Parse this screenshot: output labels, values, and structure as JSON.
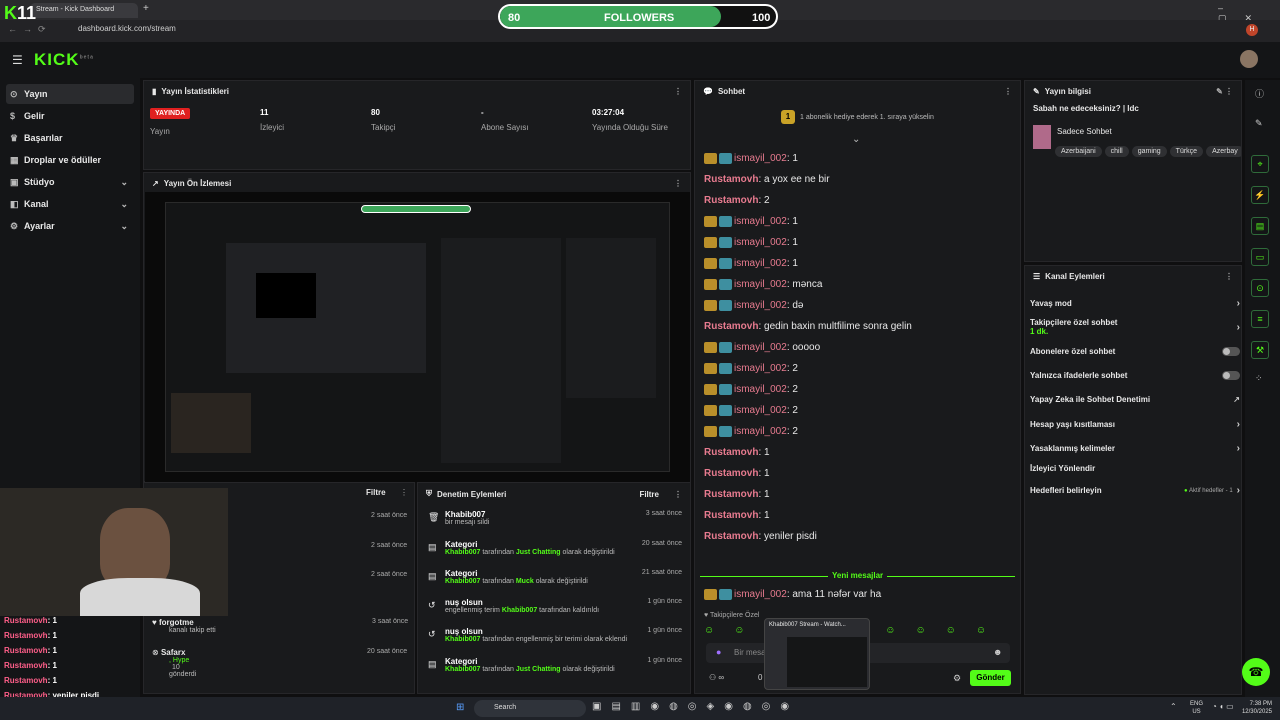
{
  "browser": {
    "tab_title": "Stream - Kick Dashboard",
    "url": "dashboard.kick.com/stream",
    "profile_initial": "H"
  },
  "overlay": {
    "logo_k": "K",
    "logo_num": "11",
    "followers_left": "80",
    "followers_label": "FOLLOWERS",
    "followers_right": "100",
    "followers_progress": 0.8
  },
  "app": {
    "logo": "KICK",
    "logo_sup": "beta"
  },
  "sidebar": {
    "items": [
      {
        "label": "Yayın",
        "icon": "broadcast-icon"
      },
      {
        "label": "Gelir",
        "icon": "money-icon"
      },
      {
        "label": "Başarılar",
        "icon": "trophy-icon"
      },
      {
        "label": "Droplar ve ödüller",
        "icon": "gift-icon"
      },
      {
        "label": "Stüdyo",
        "icon": "studio-icon"
      },
      {
        "label": "Kanal",
        "icon": "channel-icon"
      },
      {
        "label": "Ayarlar",
        "icon": "gear-icon"
      }
    ]
  },
  "stats": {
    "title": "Yayın İstatistikleri",
    "live": "YAYINDA",
    "live_label": "Yayın",
    "viewers": "11",
    "viewers_label": "İzleyici",
    "followers": "80",
    "followers_label": "Takipçi",
    "subs": "-",
    "subs_label": "Abone Sayısı",
    "uptime": "03:27:04",
    "uptime_label": "Yayında Olduğu Süre"
  },
  "preview": {
    "title": "Yayın Ön İzlemesi"
  },
  "activity": {
    "filter": "Filtre",
    "times": [
      "2 saat önce",
      "2 saat önce",
      "2 saat önce"
    ],
    "rows": [
      {
        "name": "forgotme",
        "desc": "kanalı takip etti",
        "time": "3 saat önce"
      },
      {
        "name": "Safarx",
        "desc": ", Hype",
        "extra": "10",
        "extra2": "gönderdi",
        "time": "20 saat önce"
      }
    ]
  },
  "mod_log": {
    "title": "Denetim Eylemleri",
    "filter": "Filtre",
    "rows": [
      {
        "title": "Khabib007",
        "desc": "bir mesajı sildi",
        "time": "3 saat önce"
      },
      {
        "title": "Kategori",
        "user": "Khabib007",
        "mid": "tarafından",
        "cat": "Just Chatting",
        "end": "olarak değiştirildi",
        "time": "20 saat önce"
      },
      {
        "title": "Kategori",
        "user": "Khabib007",
        "mid": "tarafından",
        "cat": "Muck",
        "end": "olarak değiştirildi",
        "time": "21 saat önce"
      },
      {
        "title": "nuş olsun",
        "desc": "engellenmiş terim",
        "user": "Khabib007",
        "end": "tarafından kaldırıldı",
        "time": "1 gün önce"
      },
      {
        "title": "nuş olsun",
        "user": "Khabib007",
        "end": "tarafından engellenmiş bir terimi olarak eklendi",
        "time": "1 gün önce"
      },
      {
        "title": "Kategori",
        "user": "Khabib007",
        "mid": "tarafından",
        "cat": "Just Chatting",
        "end": "olarak değiştirildi",
        "time": "1 gün önce"
      }
    ]
  },
  "chat": {
    "title": "Sohbet",
    "pinned": "1 abonelik hediye ederek 1. sıraya yükselin",
    "pinned_num": "1",
    "new_messages": "Yeni mesajlar",
    "placeholder": "Bir mesaj",
    "send": "Gönder",
    "followers_only": "Takipçilere Özel",
    "viewers": "0",
    "messages": [
      {
        "user": "ismayil_002",
        "text": "1",
        "badges": true
      },
      {
        "user": "Rustamovh",
        "text": "a yox ee ne bir",
        "badges": false
      },
      {
        "user": "Rustamovh",
        "text": "2",
        "badges": false
      },
      {
        "user": "ismayil_002",
        "text": "1",
        "badges": true
      },
      {
        "user": "ismayil_002",
        "text": "1",
        "badges": true
      },
      {
        "user": "ismayil_002",
        "text": "1",
        "badges": true
      },
      {
        "user": "ismayil_002",
        "text": "mənca",
        "badges": true
      },
      {
        "user": "ismayil_002",
        "text": "də",
        "badges": true
      },
      {
        "user": "Rustamovh",
        "text": "gedin baxin multfilime sonra gelin",
        "badges": false
      },
      {
        "user": "ismayil_002",
        "text": "ooooo",
        "badges": true
      },
      {
        "user": "ismayil_002",
        "text": "2",
        "badges": true
      },
      {
        "user": "ismayil_002",
        "text": "2",
        "badges": true
      },
      {
        "user": "ismayil_002",
        "text": "2",
        "badges": true
      },
      {
        "user": "ismayil_002",
        "text": "2",
        "badges": true
      },
      {
        "user": "Rustamovh",
        "text": "1",
        "badges": false
      },
      {
        "user": "Rustamovh",
        "text": "1",
        "badges": false
      },
      {
        "user": "Rustamovh",
        "text": "1",
        "badges": false
      },
      {
        "user": "Rustamovh",
        "text": "1",
        "badges": false
      },
      {
        "user": "Rustamovh",
        "text": "yeniler pisdi",
        "badges": false
      }
    ],
    "last": {
      "user": "ismayil_002",
      "text": "ama 11 nəfər var ha"
    }
  },
  "stream_info": {
    "title": "Yayın bilgisi",
    "question": "Sabah ne edeceksiniz? | ldc",
    "category": "Sadece Sohbet",
    "tags": [
      "Azerbaijani",
      "chill",
      "gaming",
      "Türkçe",
      "Azerbay"
    ]
  },
  "channel_actions": {
    "title": "Kanal Eylemleri",
    "rows": [
      {
        "label": "Yavaş mod",
        "type": "arrow"
      },
      {
        "label": "Takipçilere özel sohbet",
        "sub": "1 dk.",
        "type": "arrow"
      },
      {
        "label": "Abonelere özel sohbet",
        "type": "toggle"
      },
      {
        "label": "Yalnızca ifadelerle sohbet",
        "type": "toggle"
      },
      {
        "label": "Yapay Zeka ile Sohbet Denetimi",
        "type": "ext"
      },
      {
        "label": "Hesap yaşı kısıtlaması",
        "type": "arrow"
      },
      {
        "label": "Yasaklanmış kelimeler",
        "type": "arrow"
      },
      {
        "label": "İzleyici Yönlendir",
        "type": "none"
      },
      {
        "label": "Hedefleri belirleyin",
        "type": "arrow",
        "extra": "Aktif hedefler - 1"
      }
    ]
  },
  "overlay_chat": [
    {
      "user": "Rustamovh",
      "text": "1"
    },
    {
      "user": "Rustamovh",
      "text": "1"
    },
    {
      "user": "Rustamovh",
      "text": "1"
    },
    {
      "user": "Rustamovh",
      "text": "1"
    },
    {
      "user": "Rustamovh",
      "text": "1"
    },
    {
      "user": "Rustamovh",
      "text": "yeniler pisdi"
    },
    {
      "user": "ismayil_002",
      "text": "ama 11 nəfər var ha"
    }
  ],
  "taskbar": {
    "search": "Search",
    "lang": "ENG",
    "region": "US",
    "time": "7:38 PM",
    "date": "12/30/2025",
    "popup": "Khabib007 Stream - Watch..."
  }
}
